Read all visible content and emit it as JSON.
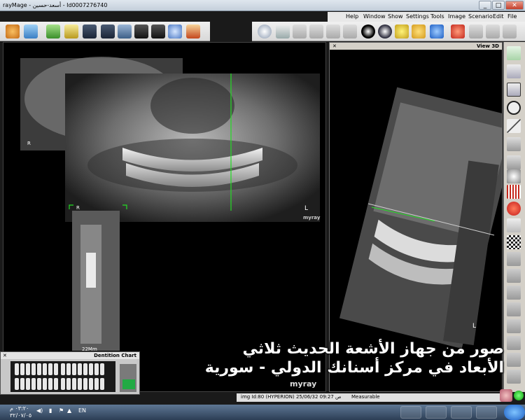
{
  "app": {
    "title": "rayMage - أسعد-حسين - Id0007276740"
  },
  "menu": {
    "items": [
      "Help",
      "Window",
      "Show",
      "Settings",
      "Tools",
      "Image",
      "Scenario",
      "Edit",
      "File"
    ]
  },
  "viewer": {
    "right_panel_title": "View 3D",
    "pano_side_left": "R",
    "pano_side_right": "L",
    "small_side_left": "R",
    "logo": "myray",
    "slice_label": "22Mm",
    "side_marker_3d": "L"
  },
  "dentition": {
    "title": "Dentition Chart"
  },
  "status": {
    "img_info": "img Id:80 (HYPERION) 25/06/32 09:27 ص",
    "measurable": "Measurable"
  },
  "caption": {
    "line1": "صور من جهاز الأشعة الحديث ثلاثي",
    "line2": "الأبعاد في مركز أسنانك الدولي - سورية"
  },
  "taskbar": {
    "time": "٠٣:٢٠ م",
    "date": "٣٢/٠٧/٠٥",
    "lang": "EN"
  },
  "colors": {
    "titlebar": "#c4cfdb",
    "green_guide": "#22dd22",
    "taskbar": "#2c3e55"
  }
}
